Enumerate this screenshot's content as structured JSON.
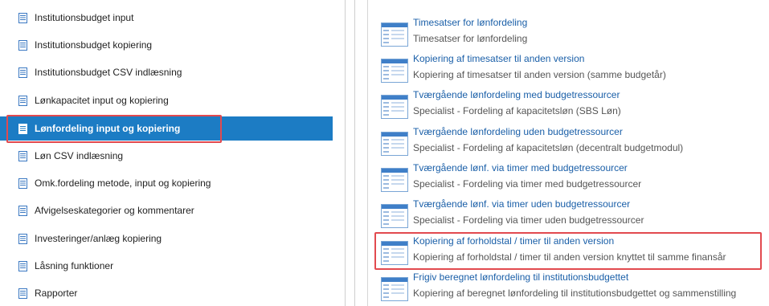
{
  "left_menu": {
    "items": [
      {
        "label": "Institutionsbudget input",
        "active": false
      },
      {
        "label": "Institutionsbudget kopiering",
        "active": false
      },
      {
        "label": "Institutionsbudget CSV indlæsning",
        "active": false
      },
      {
        "label": "Lønkapacitet input og kopiering",
        "active": false
      },
      {
        "label": "Lønfordeling input og kopiering",
        "active": true
      },
      {
        "label": "Løn CSV indlæsning",
        "active": false
      },
      {
        "label": "Omk.fordeling metode, input og kopiering",
        "active": false
      },
      {
        "label": "Afvigelseskategorier og kommentarer",
        "active": false
      },
      {
        "label": "Investeringer/anlæg kopiering",
        "active": false
      },
      {
        "label": "Låsning funktioner",
        "active": false
      },
      {
        "label": "Rapporter",
        "active": false
      }
    ]
  },
  "right_panel": {
    "items": [
      {
        "title": "Timesatser for lønfordeling",
        "description": "Timesatser for lønfordeling"
      },
      {
        "title": "Kopiering af timesatser til anden version",
        "description": "Kopiering af timesatser til anden version (samme budgetår)"
      },
      {
        "title": "Tværgående lønfordeling med budgetressourcer",
        "description": "Specialist - Fordeling af kapacitetsløn (SBS Løn)"
      },
      {
        "title": "Tværgående lønfordeling uden budgetressourcer",
        "description": "Specialist - Fordeling af kapacitetsløn (decentralt budgetmodul)"
      },
      {
        "title": "Tværgående lønf. via timer med budgetressourcer",
        "description": "Specialist - Fordeling via timer med budgetressourcer"
      },
      {
        "title": "Tværgående lønf. via timer uden budgetressourcer",
        "description": "Specialist - Fordeling via timer uden budgetressourcer"
      },
      {
        "title": "Kopiering af forholdstal / timer til anden version",
        "description": "Kopiering af forholdstal / timer til anden version knyttet til samme finansår"
      },
      {
        "title": "Frigiv beregnet lønfordeling til institutionsbudgettet",
        "description": "Kopiering af beregnet lønfordeling til institutionsbudgettet og sammenstilling"
      }
    ]
  },
  "colors": {
    "active_bg": "#1c7cc4",
    "link": "#1a5fa8",
    "highlight": "#e24a4f"
  }
}
